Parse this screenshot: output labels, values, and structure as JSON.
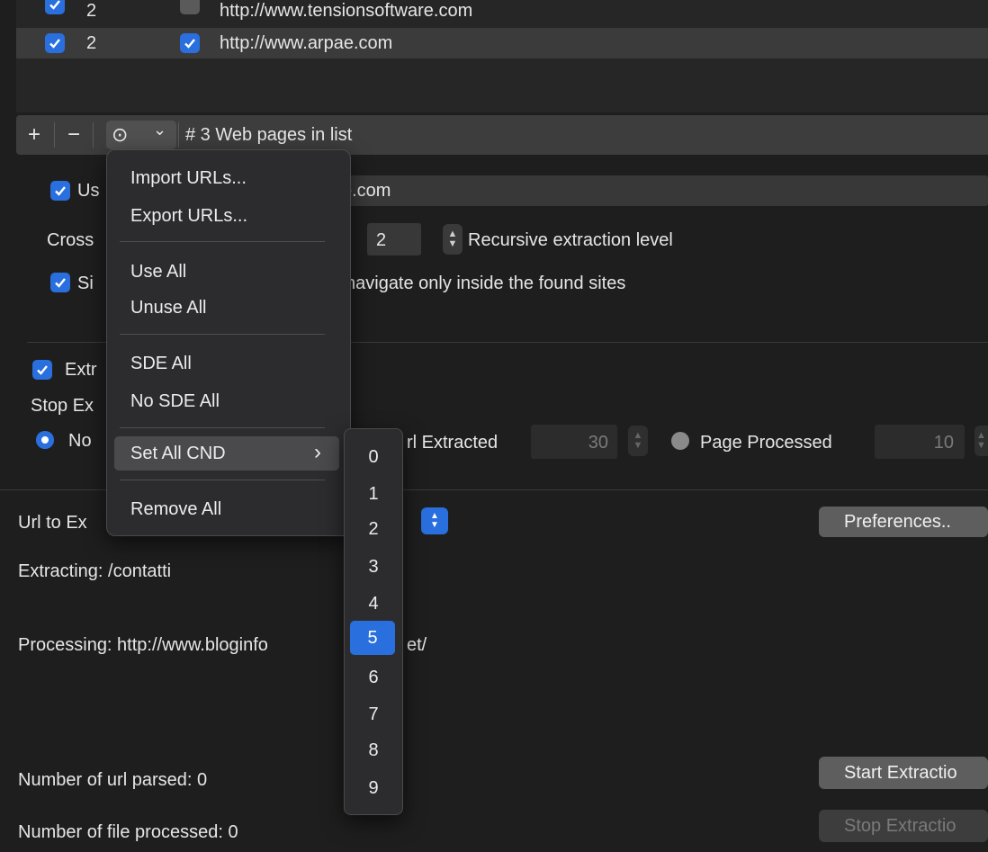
{
  "list": {
    "rows": [
      {
        "level": "2",
        "url": "http://www.tensionsoftware.com"
      },
      {
        "level": "2",
        "url": "http://www.arpae.com"
      }
    ]
  },
  "toolbar": {
    "add_label": "+",
    "remove_label": "−",
    "more_label": "⊙",
    "chevron_label": "⌄",
    "count_text": "# 3 Web pages in list"
  },
  "options": {
    "use_label": "Us",
    "use_field_value": "e.com",
    "cross_label": "Cross",
    "recursive_value": "2",
    "recursive_label": "Recursive extraction level",
    "simple_label": "Si",
    "simple_rest_label": "navigate only inside the found sites",
    "extract_label": "Extr",
    "stop_label": "Stop Ex",
    "no_label": "No",
    "url_extracted_label": "rl Extracted",
    "url_extracted_value": "30",
    "page_processed_label": "Page Processed",
    "page_processed_value": "10"
  },
  "status": {
    "url_to_extract_label": "Url to Ex",
    "extracting_text": "Extracting: /contatti",
    "processing_left": "Processing: http://www.bloginfo",
    "processing_right": "et/",
    "url_parsed_text": "Number of url parsed: 0",
    "file_processed_text": "Number of file processed: 0",
    "preferences_label": "Preferences..",
    "start_label": "Start Extractio",
    "stop_button_label": "Stop Extractio"
  },
  "menu": {
    "import_label": "Import URLs...",
    "export_label": "Export URLs...",
    "use_all_label": "Use All",
    "unuse_all_label": "Unuse All",
    "sde_all_label": "SDE All",
    "no_sde_all_label": "No SDE All",
    "set_all_cnd_label": "Set All CND",
    "submenu_arrow": "›",
    "remove_all_label": "Remove All"
  },
  "submenu": {
    "items": [
      "0",
      "1",
      "2",
      "3",
      "4",
      "5",
      "6",
      "7",
      "8",
      "9"
    ],
    "selected": "5"
  },
  "colors": {
    "accent": "#2a6fde",
    "background": "#1e1e1e",
    "menu_bg": "#2c2c2e"
  }
}
